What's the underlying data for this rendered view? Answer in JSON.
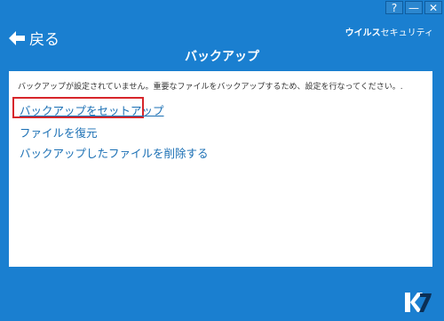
{
  "window": {
    "help_label": "?",
    "minimize_label": "—",
    "close_label": "✕"
  },
  "header": {
    "back_label": "戻る",
    "brand_bold": "ウイルス",
    "brand_light": "セキュリティ",
    "title": "バックアップ"
  },
  "panel": {
    "description": "バックアップが設定されていません。重要なファイルをバックアップするため、設定を行なってください。.",
    "links": [
      {
        "label": "バックアップをセットアップ"
      },
      {
        "label": "ファイルを復元"
      },
      {
        "label": "バックアップしたファイルを削除する"
      }
    ]
  },
  "colors": {
    "background": "#1a7fd0",
    "panel": "#ffffff",
    "link": "#1a6fb4",
    "highlight": "#d7262b"
  },
  "icons": {
    "back": "back-arrow-icon",
    "logo": "k7-logo-icon"
  }
}
